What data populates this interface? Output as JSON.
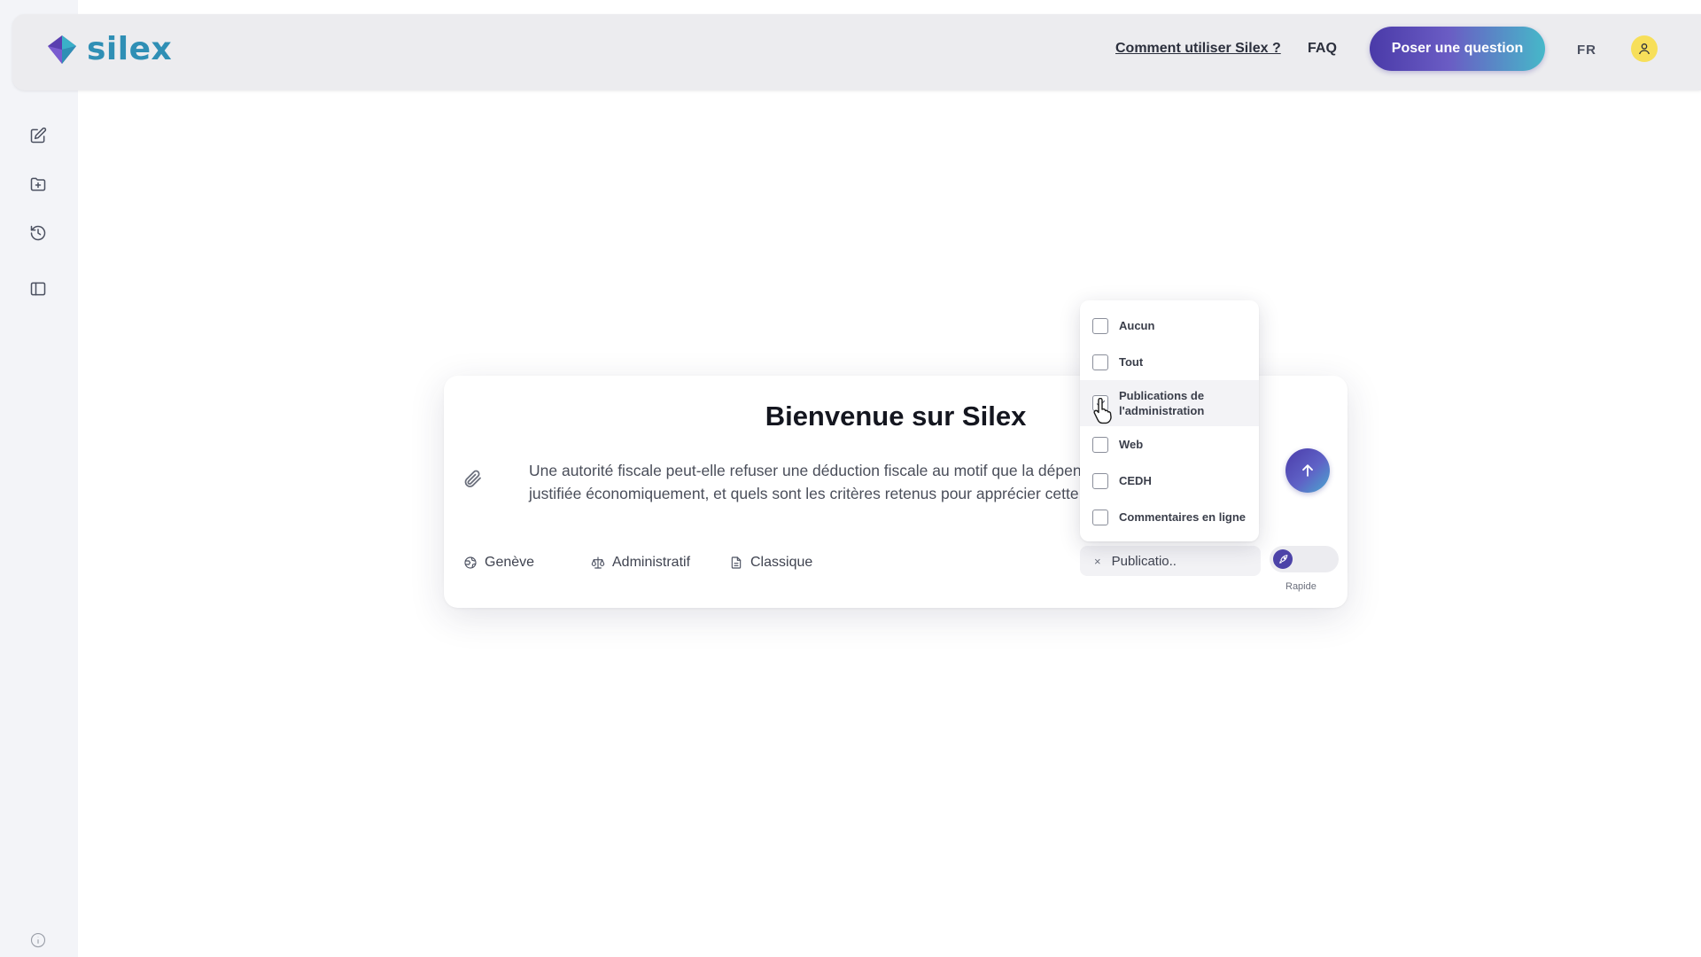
{
  "app": {
    "logo_text": "silex",
    "brand_colors": {
      "primary": "#4a3aa8",
      "secondary": "#46b8c9",
      "logo": "#2f8fb5"
    }
  },
  "header": {
    "how_to_link": "Comment utiliser Silex ?",
    "faq_link": "FAQ",
    "ask_button": "Poser une question",
    "language": "FR",
    "user_icon": "user-icon"
  },
  "sidebar": {
    "items": [
      {
        "icon": "edit-icon",
        "label": "new-chat"
      },
      {
        "icon": "folder-add-icon",
        "label": "folders"
      },
      {
        "icon": "history-icon",
        "label": "history"
      },
      {
        "icon": "sidebar-toggle-icon",
        "label": "toggle-sidebar"
      }
    ],
    "info_icon": "info-icon"
  },
  "main": {
    "title": "Bienvenue sur Silex",
    "query_text": "Une autorité fiscale peut-elle refuser une déduction fiscale au motif que la dépense ne serait pas justifiée économiquement, et quels sont les critères retenus pour apprécier cette justification ?",
    "chips": [
      {
        "icon": "globe-icon",
        "label": "Genève"
      },
      {
        "icon": "scale-icon",
        "label": "Administratif"
      },
      {
        "icon": "document-icon",
        "label": "Classique"
      }
    ],
    "source_select": {
      "clear": "×",
      "value": "Publicatio.."
    },
    "mode_toggle": {
      "label": "Rapide",
      "icon": "rocket-icon"
    }
  },
  "dropdown": {
    "options": [
      {
        "label": "Aucun",
        "checked": false
      },
      {
        "label": "Tout",
        "checked": false
      },
      {
        "label": "Publications de l'administration",
        "checked": true
      },
      {
        "label": "Web",
        "checked": false
      },
      {
        "label": "CEDH",
        "checked": false
      },
      {
        "label": "Commentaires en ligne",
        "checked": false
      }
    ]
  }
}
